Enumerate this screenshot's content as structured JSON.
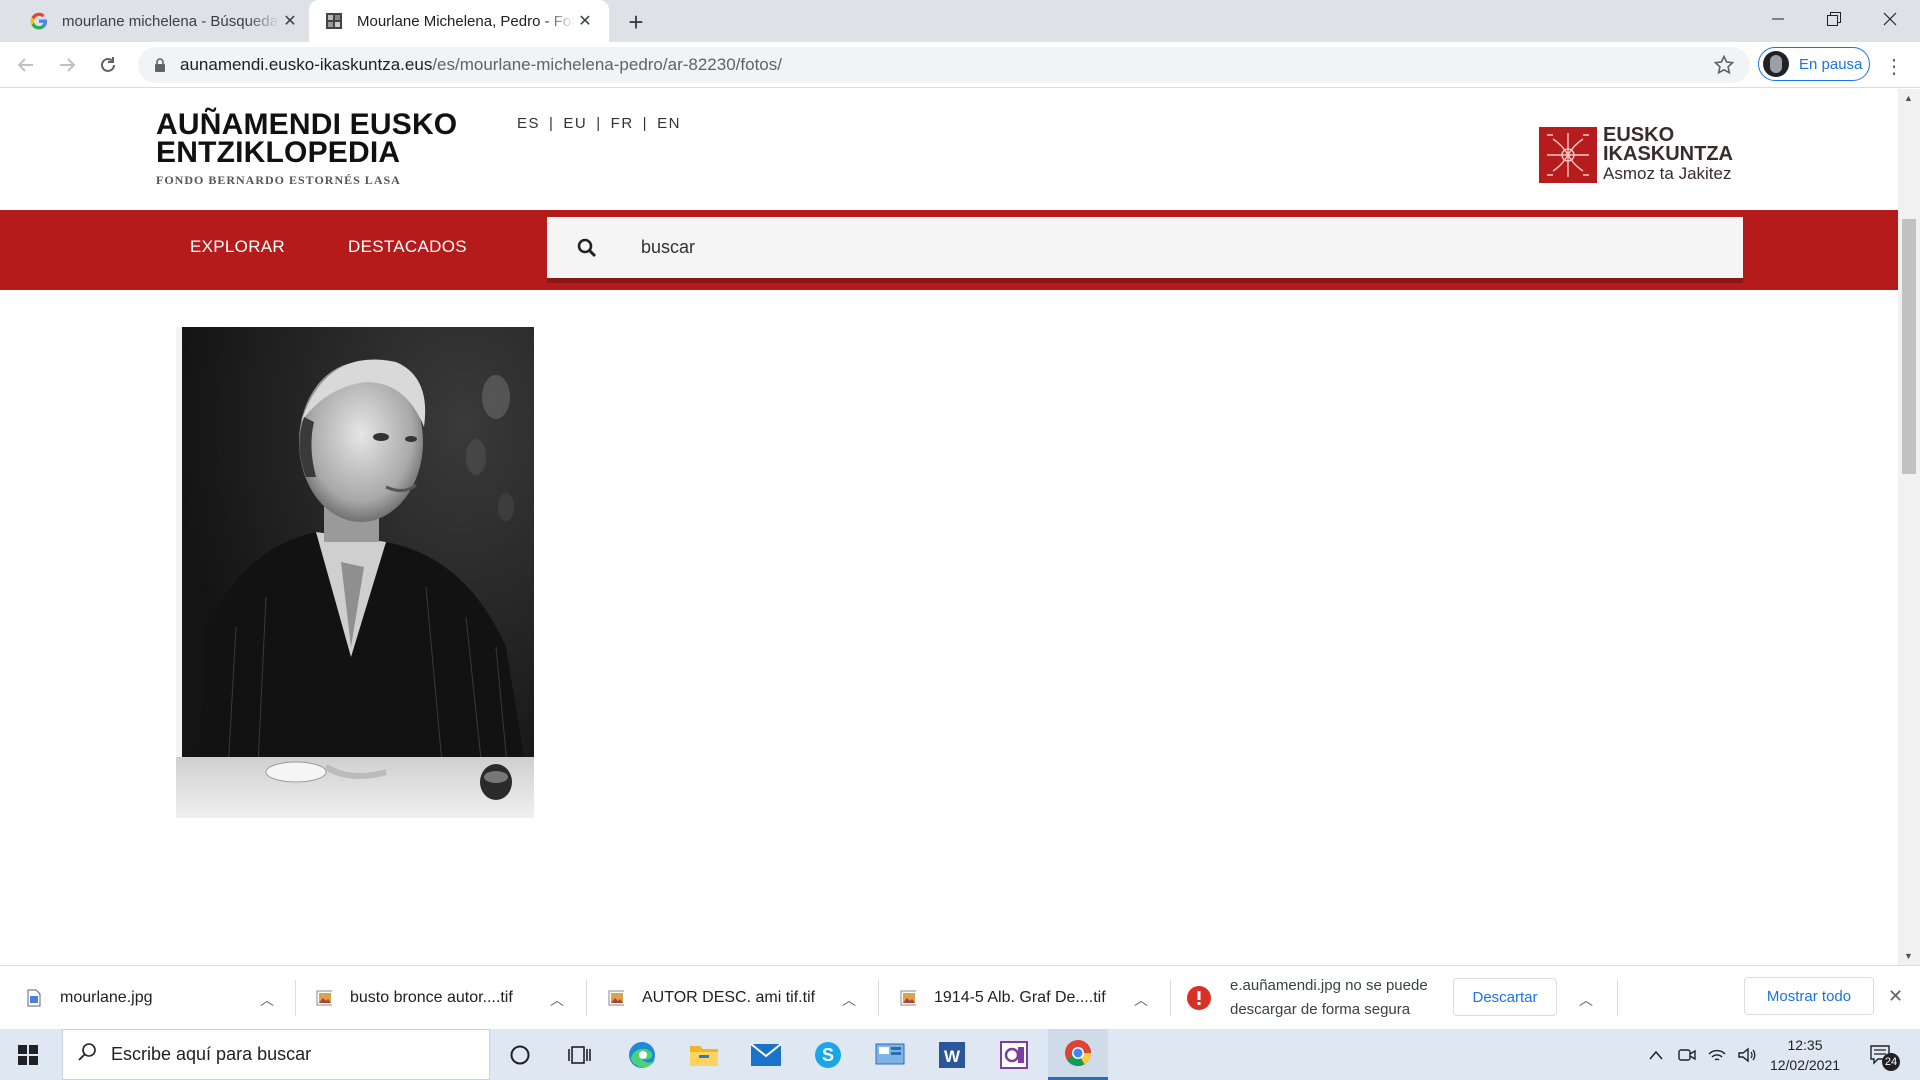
{
  "browser": {
    "tabs": [
      {
        "title": "mourlane michelena - Búsqueda",
        "icon": "google-g-icon",
        "active": false
      },
      {
        "title": "Mourlane Michelena, Pedro - Fotos",
        "icon": "site-favicon-icon",
        "active": true
      }
    ],
    "url_host": "aunamendi.eusko-ikaskuntza.eus",
    "url_path": "/es/mourlane-michelena-pedro/ar-82230/fotos/",
    "profile_label": "En pausa"
  },
  "site": {
    "brand_line1": "AUÑAMENDI EUSKO",
    "brand_line2": "ENTZIKLOPEDIA",
    "brand_sub": "FONDO BERNARDO ESTORNÉS LASA",
    "languages": [
      "ES",
      "EU",
      "FR",
      "EN"
    ],
    "lang_sep": "|",
    "partner_logo": {
      "line1": "EUSKO",
      "line2": "IKASKUNTZA",
      "line3": "Asmoz ta Jakitez"
    },
    "nav": {
      "explore": "EXPLORAR",
      "featured": "DESTACADOS"
    },
    "search_placeholder": "buscar",
    "accent_color": "#b51b1b"
  },
  "downloads": {
    "items": [
      {
        "name": "mourlane.jpg"
      },
      {
        "name": "busto bronce autor....tif"
      },
      {
        "name": "AUTOR DESC. ami tif.tif"
      },
      {
        "name": "1914-5 Alb. Graf De....tif"
      }
    ],
    "warning_line1": "e.auñamendi.jpg no se puede",
    "warning_line2": "descargar de forma segura",
    "discard_label": "Descartar",
    "show_all_label": "Mostrar todo"
  },
  "taskbar": {
    "search_placeholder": "Escribe aquí para buscar",
    "time": "12:35",
    "date": "12/02/2021",
    "notification_count": "24"
  }
}
